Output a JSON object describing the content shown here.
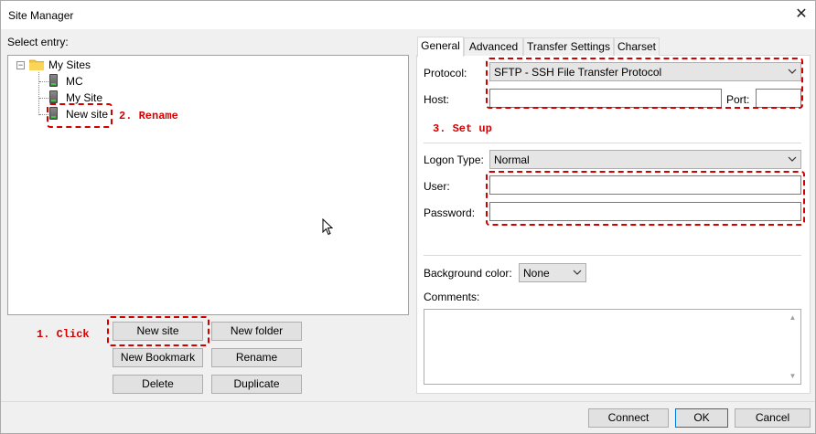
{
  "window": {
    "title": "Site Manager",
    "close_glyph": "✕"
  },
  "left": {
    "select_entry_label": "Select entry:",
    "tree": {
      "root": {
        "label": "My Sites",
        "expander": "−",
        "icon": "folder-icon"
      },
      "children": [
        {
          "label": "MC",
          "icon": "server-icon"
        },
        {
          "label": "My Site",
          "icon": "server-icon"
        },
        {
          "label": "New site",
          "icon": "server-icon"
        }
      ]
    },
    "buttons": {
      "new_site": "New site",
      "new_folder": "New folder",
      "new_bookmark": "New Bookmark",
      "rename": "Rename",
      "delete": "Delete",
      "duplicate": "Duplicate"
    }
  },
  "annotations": {
    "click": "1. Click",
    "rename": "2. Rename",
    "setup": "3. Set up",
    "color": "#d40000"
  },
  "tabs": [
    {
      "label": "General",
      "active": true
    },
    {
      "label": "Advanced",
      "active": false
    },
    {
      "label": "Transfer Settings",
      "active": false
    },
    {
      "label": "Charset",
      "active": false
    }
  ],
  "general": {
    "protocol_label": "Protocol:",
    "protocol_value": "SFTP - SSH File Transfer Protocol",
    "host_label": "Host:",
    "host_value": "",
    "port_label": "Port:",
    "port_value": "",
    "logon_type_label": "Logon Type:",
    "logon_type_value": "Normal",
    "user_label": "User:",
    "user_value": "",
    "password_label": "Password:",
    "password_value": "",
    "bg_color_label": "Background color:",
    "bg_color_value": "None",
    "comments_label": "Comments:",
    "comments_value": ""
  },
  "footer": {
    "connect": "Connect",
    "ok": "OK",
    "cancel": "Cancel"
  }
}
